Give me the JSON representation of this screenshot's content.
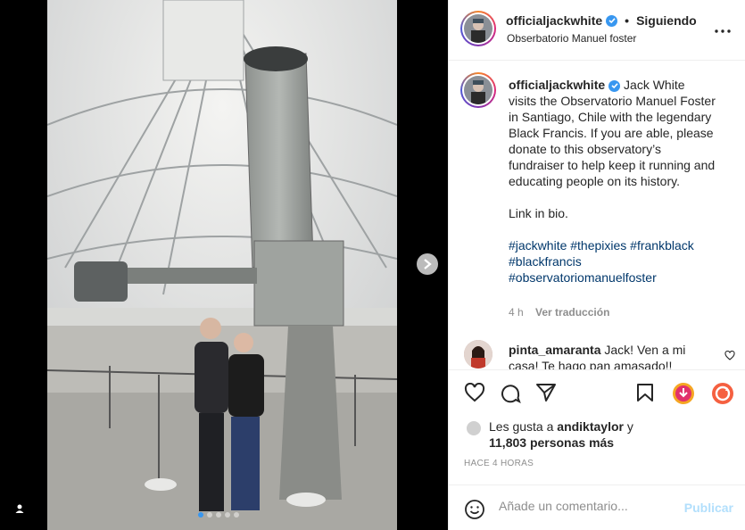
{
  "post": {
    "username": "officialjackwhite",
    "follow_status": "Siguiendo",
    "separator": "•",
    "location": "Obserbatorio Manuel foster"
  },
  "caption": {
    "username": "officialjackwhite",
    "text": " Jack White visits the Observatorio Manuel Foster in Santiago, Chile with the legendary Black Francis. If you are able, please donate to this observatory’s fundraiser to help keep it running and educating people on its history.",
    "link_text": "Link in bio.",
    "hashtags": "#jackwhite #thepixies #frankblack #blackfrancis #observatoriomanuelfoster",
    "time": "4 h",
    "translate": "Ver traducción"
  },
  "comment": {
    "username": "pinta_amaranta",
    "text": " Jack! Ven a mi casa! Te hago pan amasado!!"
  },
  "likes": {
    "prefix": "Les gusta a ",
    "user": "andiktaylor",
    "mid": " y",
    "count": "11,803 personas más"
  },
  "timestamp": "HACE 4 HORAS",
  "composer": {
    "placeholder": "Añade un comentario...",
    "publish": "Publicar"
  },
  "carousel": {
    "slides": 5,
    "active": 0
  },
  "colors": {
    "link": "#00376b",
    "verified": "#3897f0",
    "publish_disabled": "#b2dffc"
  },
  "icons": [
    "verified-icon",
    "more-icon",
    "heart-icon",
    "comment-icon",
    "share-icon",
    "bookmark-icon",
    "download-icon",
    "sync-icon",
    "emoji-icon",
    "next-arrow-icon",
    "user-tag-icon"
  ]
}
